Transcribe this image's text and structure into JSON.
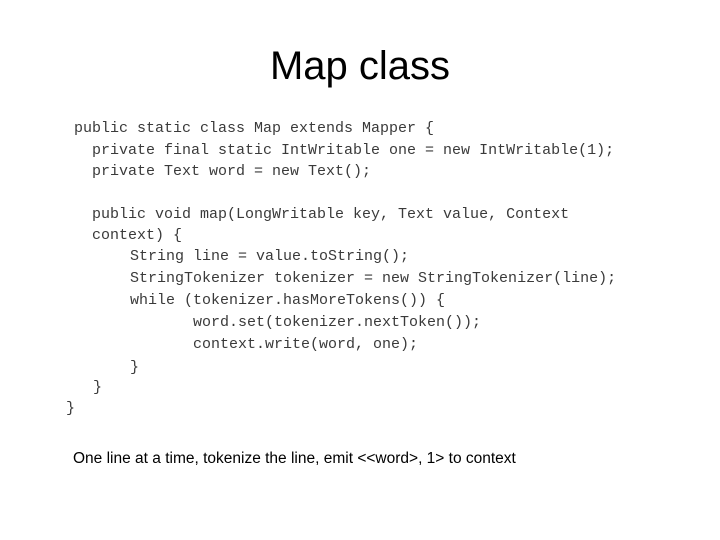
{
  "slide": {
    "title": "Map class",
    "code_lines": [
      "public static class Map extends Mapper {",
      "private final static IntWritable one = new IntWritable(1);",
      "private Text word = new Text();",
      "public void map(LongWritable key, Text value, Context",
      "context) {",
      "String line = value.toString();",
      "StringTokenizer tokenizer = new StringTokenizer(line);",
      "while (tokenizer.hasMoreTokens()) {",
      "word.set(tokenizer.nextToken());",
      "context.write(word, one);",
      "}",
      "}",
      "}"
    ],
    "caption": "One line at a time, tokenize the line, emit <<word>, 1> to context"
  }
}
